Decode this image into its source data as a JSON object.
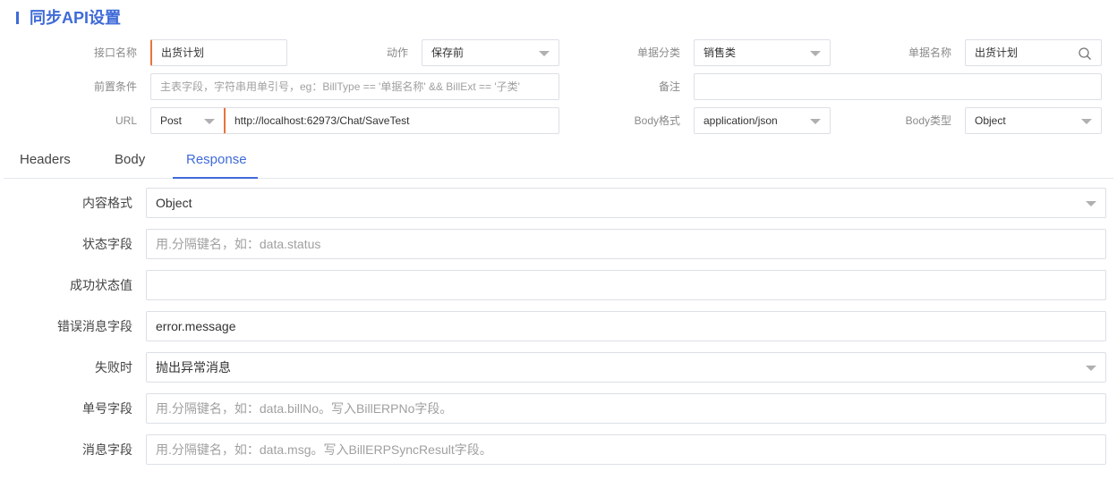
{
  "title": "同步API设置",
  "form": {
    "interface_name": {
      "label": "接口名称",
      "value": "出货计划"
    },
    "action": {
      "label": "动作",
      "value": "保存前"
    },
    "bill_category": {
      "label": "单据分类",
      "value": "销售类"
    },
    "bill_name": {
      "label": "单据名称",
      "value": "出货计划"
    },
    "precondition": {
      "label": "前置条件",
      "placeholder": "主表字段，字符串用单引号，eg：BillType == '单据名称' && BillExt == '子类'"
    },
    "remark": {
      "label": "备注",
      "value": ""
    },
    "url": {
      "label": "URL",
      "method": "Post",
      "value": "http://localhost:62973/Chat/SaveTest"
    },
    "body_format": {
      "label": "Body格式",
      "value": "application/json"
    },
    "body_type": {
      "label": "Body类型",
      "value": "Object"
    }
  },
  "tabs": [
    {
      "label": "Headers",
      "active": false
    },
    {
      "label": "Body",
      "active": false
    },
    {
      "label": "Response",
      "active": true
    }
  ],
  "response": {
    "content_format": {
      "label": "内容格式",
      "value": "Object"
    },
    "status_field": {
      "label": "状态字段",
      "placeholder": "用.分隔键名，如：data.status"
    },
    "success_value": {
      "label": "成功状态值",
      "value": ""
    },
    "error_field": {
      "label": "错误消息字段",
      "value": "error.message"
    },
    "on_failure": {
      "label": "失败时",
      "value": "抛出异常消息"
    },
    "bill_no_field": {
      "label": "单号字段",
      "placeholder": "用.分隔键名，如：data.billNo。写入BillERPNo字段。"
    },
    "message_field": {
      "label": "消息字段",
      "placeholder": "用.分隔键名，如：data.msg。写入BillERPSyncResult字段。"
    }
  },
  "colors": {
    "accent": "#3f6bd8",
    "required": "#e6743c",
    "border": "#dcdfe6"
  },
  "icons": {
    "search": "search-icon",
    "dropdown": "chevron-down-icon"
  }
}
